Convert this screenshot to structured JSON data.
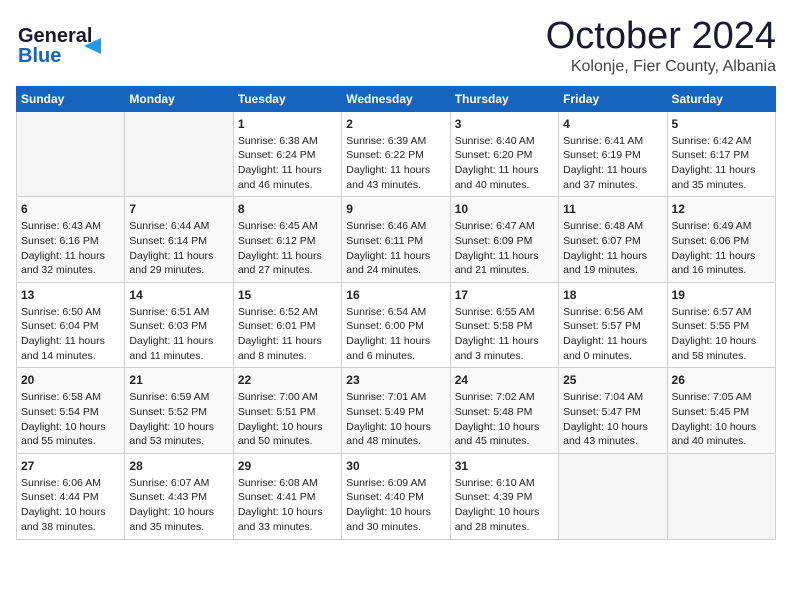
{
  "header": {
    "title": "October 2024",
    "subtitle": "Kolonje, Fier County, Albania",
    "logo_general": "General",
    "logo_blue": "Blue"
  },
  "weekdays": [
    "Sunday",
    "Monday",
    "Tuesday",
    "Wednesday",
    "Thursday",
    "Friday",
    "Saturday"
  ],
  "weeks": [
    [
      {
        "day": "",
        "empty": true
      },
      {
        "day": "",
        "empty": true
      },
      {
        "day": "1",
        "sunrise": "6:38 AM",
        "sunset": "6:24 PM",
        "daylight": "11 hours and 46 minutes."
      },
      {
        "day": "2",
        "sunrise": "6:39 AM",
        "sunset": "6:22 PM",
        "daylight": "11 hours and 43 minutes."
      },
      {
        "day": "3",
        "sunrise": "6:40 AM",
        "sunset": "6:20 PM",
        "daylight": "11 hours and 40 minutes."
      },
      {
        "day": "4",
        "sunrise": "6:41 AM",
        "sunset": "6:19 PM",
        "daylight": "11 hours and 37 minutes."
      },
      {
        "day": "5",
        "sunrise": "6:42 AM",
        "sunset": "6:17 PM",
        "daylight": "11 hours and 35 minutes."
      }
    ],
    [
      {
        "day": "6",
        "sunrise": "6:43 AM",
        "sunset": "6:16 PM",
        "daylight": "11 hours and 32 minutes."
      },
      {
        "day": "7",
        "sunrise": "6:44 AM",
        "sunset": "6:14 PM",
        "daylight": "11 hours and 29 minutes."
      },
      {
        "day": "8",
        "sunrise": "6:45 AM",
        "sunset": "6:12 PM",
        "daylight": "11 hours and 27 minutes."
      },
      {
        "day": "9",
        "sunrise": "6:46 AM",
        "sunset": "6:11 PM",
        "daylight": "11 hours and 24 minutes."
      },
      {
        "day": "10",
        "sunrise": "6:47 AM",
        "sunset": "6:09 PM",
        "daylight": "11 hours and 21 minutes."
      },
      {
        "day": "11",
        "sunrise": "6:48 AM",
        "sunset": "6:07 PM",
        "daylight": "11 hours and 19 minutes."
      },
      {
        "day": "12",
        "sunrise": "6:49 AM",
        "sunset": "6:06 PM",
        "daylight": "11 hours and 16 minutes."
      }
    ],
    [
      {
        "day": "13",
        "sunrise": "6:50 AM",
        "sunset": "6:04 PM",
        "daylight": "11 hours and 14 minutes."
      },
      {
        "day": "14",
        "sunrise": "6:51 AM",
        "sunset": "6:03 PM",
        "daylight": "11 hours and 11 minutes."
      },
      {
        "day": "15",
        "sunrise": "6:52 AM",
        "sunset": "6:01 PM",
        "daylight": "11 hours and 8 minutes."
      },
      {
        "day": "16",
        "sunrise": "6:54 AM",
        "sunset": "6:00 PM",
        "daylight": "11 hours and 6 minutes."
      },
      {
        "day": "17",
        "sunrise": "6:55 AM",
        "sunset": "5:58 PM",
        "daylight": "11 hours and 3 minutes."
      },
      {
        "day": "18",
        "sunrise": "6:56 AM",
        "sunset": "5:57 PM",
        "daylight": "11 hours and 0 minutes."
      },
      {
        "day": "19",
        "sunrise": "6:57 AM",
        "sunset": "5:55 PM",
        "daylight": "10 hours and 58 minutes."
      }
    ],
    [
      {
        "day": "20",
        "sunrise": "6:58 AM",
        "sunset": "5:54 PM",
        "daylight": "10 hours and 55 minutes."
      },
      {
        "day": "21",
        "sunrise": "6:59 AM",
        "sunset": "5:52 PM",
        "daylight": "10 hours and 53 minutes."
      },
      {
        "day": "22",
        "sunrise": "7:00 AM",
        "sunset": "5:51 PM",
        "daylight": "10 hours and 50 minutes."
      },
      {
        "day": "23",
        "sunrise": "7:01 AM",
        "sunset": "5:49 PM",
        "daylight": "10 hours and 48 minutes."
      },
      {
        "day": "24",
        "sunrise": "7:02 AM",
        "sunset": "5:48 PM",
        "daylight": "10 hours and 45 minutes."
      },
      {
        "day": "25",
        "sunrise": "7:04 AM",
        "sunset": "5:47 PM",
        "daylight": "10 hours and 43 minutes."
      },
      {
        "day": "26",
        "sunrise": "7:05 AM",
        "sunset": "5:45 PM",
        "daylight": "10 hours and 40 minutes."
      }
    ],
    [
      {
        "day": "27",
        "sunrise": "6:06 AM",
        "sunset": "4:44 PM",
        "daylight": "10 hours and 38 minutes."
      },
      {
        "day": "28",
        "sunrise": "6:07 AM",
        "sunset": "4:43 PM",
        "daylight": "10 hours and 35 minutes."
      },
      {
        "day": "29",
        "sunrise": "6:08 AM",
        "sunset": "4:41 PM",
        "daylight": "10 hours and 33 minutes."
      },
      {
        "day": "30",
        "sunrise": "6:09 AM",
        "sunset": "4:40 PM",
        "daylight": "10 hours and 30 minutes."
      },
      {
        "day": "31",
        "sunrise": "6:10 AM",
        "sunset": "4:39 PM",
        "daylight": "10 hours and 28 minutes."
      },
      {
        "day": "",
        "empty": true
      },
      {
        "day": "",
        "empty": true
      }
    ]
  ]
}
